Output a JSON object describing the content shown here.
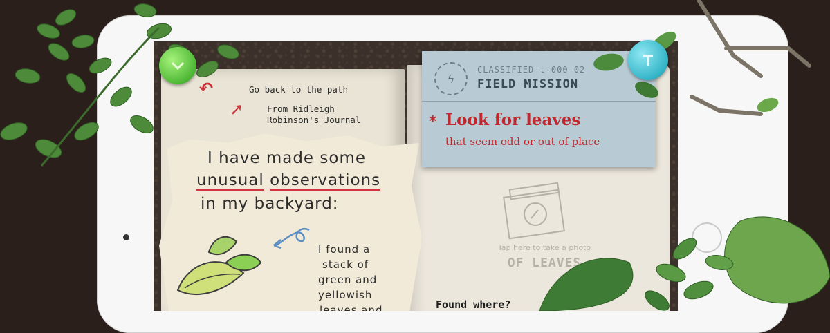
{
  "journal": {
    "back_label": "Go back to the path",
    "source_label_1": "From Ridleigh",
    "source_label_2": "Robinson's Journal",
    "entry_line_1": "I have made some",
    "entry_word_unusual": "unusual",
    "entry_word_observations": "observations",
    "entry_line_3": "in my backyard:",
    "found_line_1": "I found a",
    "found_line_2": "stack of",
    "found_line_3": "green and",
    "found_line_4": "yellowish",
    "found_line_5": "leaves and"
  },
  "mission": {
    "classified": "CLASSIFIED t-000-02",
    "title": "FIELD MISSION",
    "star": "*",
    "main": "Look for leaves",
    "sub": "that seem odd or out of place"
  },
  "photo": {
    "hint": "Tap here to take a photo",
    "label": "OF LEAVES"
  },
  "found_where": "Found where?",
  "icons": {
    "green_button": "chevron-down-icon",
    "teal_button": "t-shape-icon",
    "stamp": "stamp-icon",
    "camera": "camera-icon"
  },
  "colors": {
    "accent_red": "#c1272d",
    "card_blue": "#b8cbd5",
    "button_green": "#4fb836",
    "button_teal": "#34b5c8"
  }
}
